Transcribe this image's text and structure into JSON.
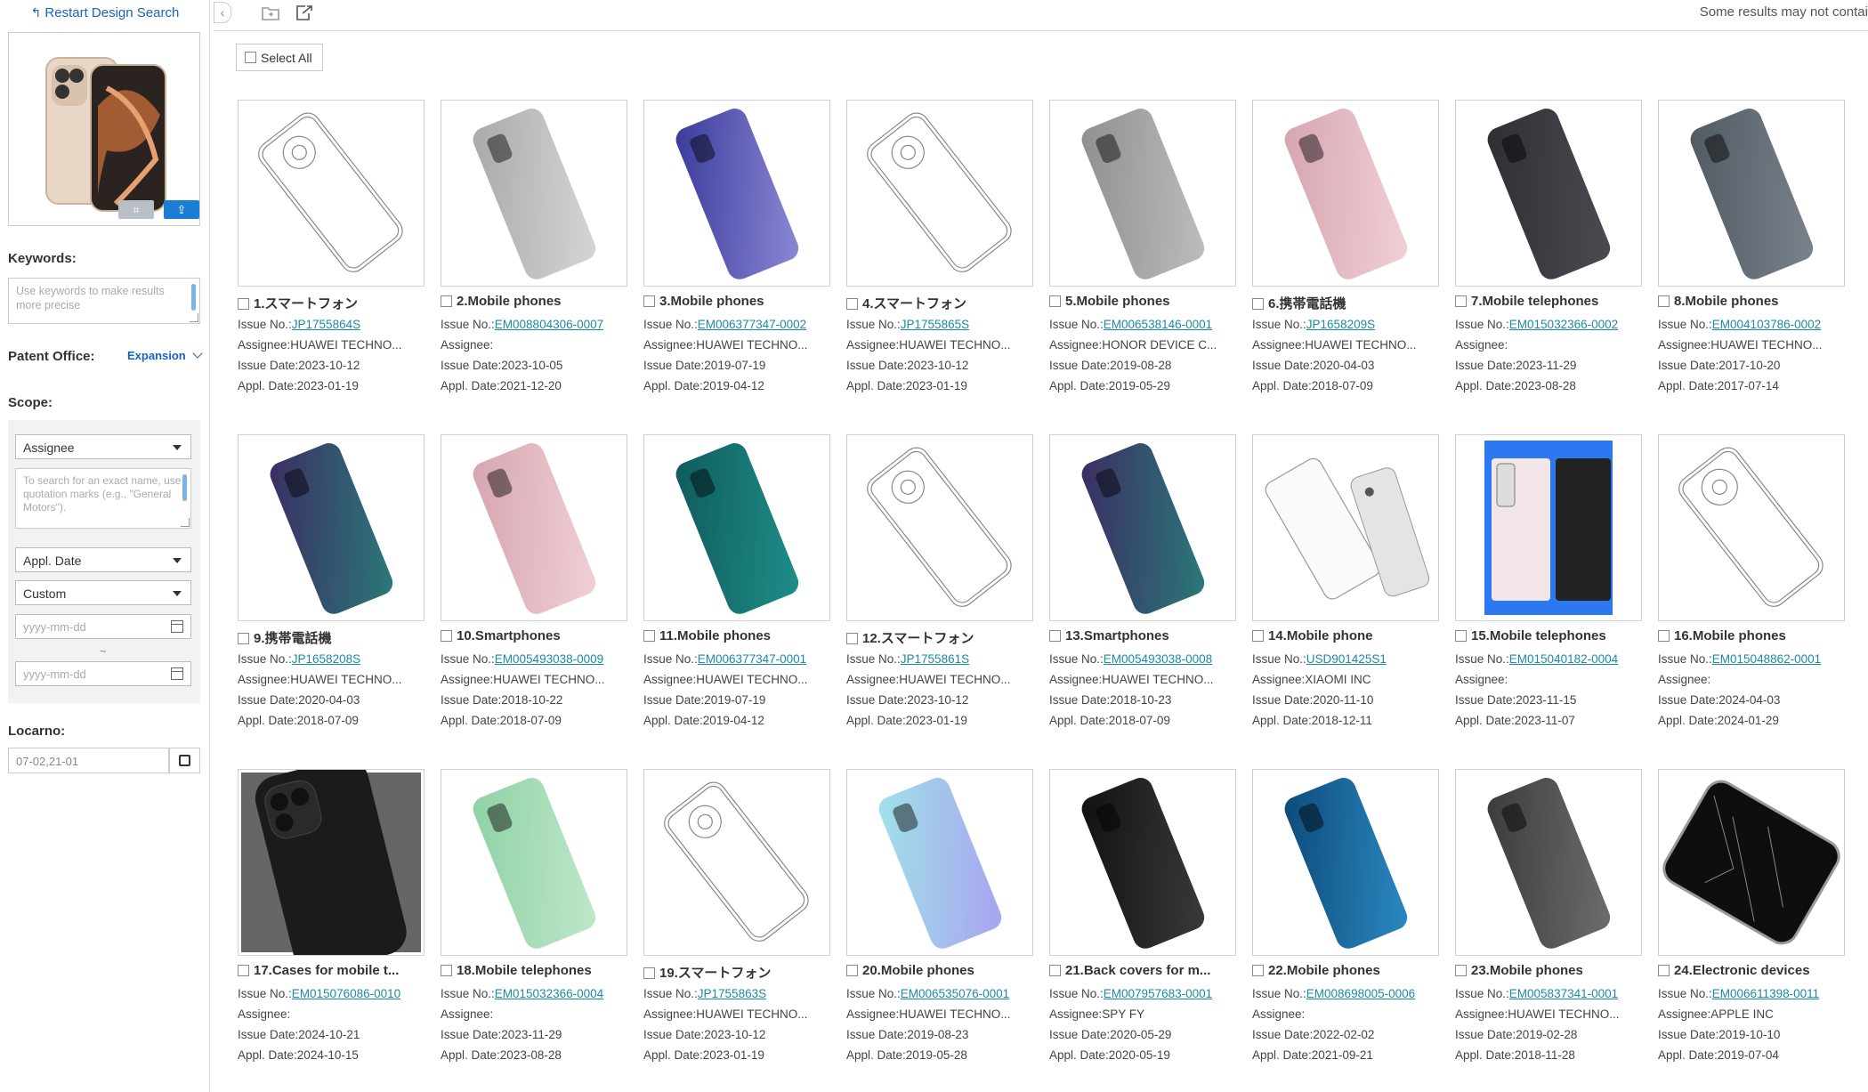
{
  "sidebar": {
    "restart_label": "Restart Design Search",
    "keywords_label": "Keywords:",
    "keywords_placeholder": "Use keywords to make results more precise",
    "patent_office_label": "Patent Office:",
    "expansion_label": "Expansion",
    "scope_label": "Scope:",
    "scope_field": "Assignee",
    "scope_placeholder": "To search for an exact name, use quotation marks (e.g., \"General Motors\").",
    "date_field": "Appl. Date",
    "date_range": "Custom",
    "date_from_placeholder": "yyyy-mm-dd",
    "date_sep": "~",
    "date_to_placeholder": "yyyy-mm-dd",
    "locarno_label": "Locarno:",
    "locarno_value": "07-02,21-01"
  },
  "topbar": {
    "note": "Some results may not contai"
  },
  "results": {
    "select_all_label": "Select All",
    "field_labels": {
      "issue_no": "Issue No.:",
      "assignee": "Assignee:",
      "issue_date": "Issue Date:",
      "appl_date": "Appl. Date:"
    },
    "items": [
      {
        "title": "1.スマートフォン",
        "issue_no": "JP1755864S",
        "assignee": "HUAWEI TECHNO...",
        "issue_date": "2023-10-12",
        "appl_date": "2023-01-19",
        "thumb": "line-art"
      },
      {
        "title": "2.Mobile phones",
        "issue_no": "EM008804306-0007",
        "assignee": "",
        "issue_date": "2023-10-05",
        "appl_date": "2021-12-20",
        "thumb": "silver"
      },
      {
        "title": "3.Mobile phones",
        "issue_no": "EM006377347-0002",
        "assignee": "HUAWEI TECHNO...",
        "issue_date": "2019-07-19",
        "appl_date": "2019-04-12",
        "thumb": "purple"
      },
      {
        "title": "4.スマートフォン",
        "issue_no": "JP1755865S",
        "assignee": "HUAWEI TECHNO...",
        "issue_date": "2023-10-12",
        "appl_date": "2023-01-19",
        "thumb": "line-art"
      },
      {
        "title": "5.Mobile phones",
        "issue_no": "EM006538146-0001",
        "assignee": "HONOR DEVICE C...",
        "issue_date": "2019-08-28",
        "appl_date": "2019-05-29",
        "thumb": "grey"
      },
      {
        "title": "6.携帯電話機",
        "issue_no": "JP1658209S",
        "assignee": "HUAWEI TECHNO...",
        "issue_date": "2020-04-03",
        "appl_date": "2018-07-09",
        "thumb": "pink"
      },
      {
        "title": "7.Mobile telephones",
        "issue_no": "EM015032366-0002",
        "assignee": "",
        "issue_date": "2023-11-29",
        "appl_date": "2023-08-28",
        "thumb": "dark-g"
      },
      {
        "title": "8.Mobile phones",
        "issue_no": "EM004103786-0002",
        "assignee": "HUAWEI TECHNO...",
        "issue_date": "2017-10-20",
        "appl_date": "2017-07-14",
        "thumb": "slate"
      },
      {
        "title": "9.携帯電話機",
        "issue_no": "JP1658208S",
        "assignee": "HUAWEI TECHNO...",
        "issue_date": "2020-04-03",
        "appl_date": "2018-07-09",
        "thumb": "twilight"
      },
      {
        "title": "10.Smartphones",
        "issue_no": "EM005493038-0009",
        "assignee": "HUAWEI TECHNO...",
        "issue_date": "2018-10-22",
        "appl_date": "2018-07-09",
        "thumb": "pink"
      },
      {
        "title": "11.Mobile phones",
        "issue_no": "EM006377347-0001",
        "assignee": "HUAWEI TECHNO...",
        "issue_date": "2019-07-19",
        "appl_date": "2019-04-12",
        "thumb": "teal"
      },
      {
        "title": "12.スマートフォン",
        "issue_no": "JP1755861S",
        "assignee": "HUAWEI TECHNO...",
        "issue_date": "2023-10-12",
        "appl_date": "2023-01-19",
        "thumb": "line-art"
      },
      {
        "title": "13.Smartphones",
        "issue_no": "EM005493038-0008",
        "assignee": "HUAWEI TECHNO...",
        "issue_date": "2018-10-23",
        "appl_date": "2018-07-09",
        "thumb": "twilight"
      },
      {
        "title": "14.Mobile phone",
        "issue_no": "USD901425S1",
        "assignee": "XIAOMI INC",
        "issue_date": "2020-11-10",
        "appl_date": "2018-12-11",
        "thumb": "white-pair"
      },
      {
        "title": "15.Mobile telephones",
        "issue_no": "EM015040182-0004",
        "assignee": "",
        "issue_date": "2023-11-15",
        "appl_date": "2023-11-07",
        "thumb": "blue-bg"
      },
      {
        "title": "16.Mobile phones",
        "issue_no": "EM015048862-0001",
        "assignee": "",
        "issue_date": "2024-04-03",
        "appl_date": "2024-01-29",
        "thumb": "line-art-round"
      },
      {
        "title": "17.Cases for mobile t...",
        "issue_no": "EM015076086-0010",
        "assignee": "",
        "issue_date": "2024-10-21",
        "appl_date": "2024-10-15",
        "thumb": "black-case"
      },
      {
        "title": "18.Mobile telephones",
        "issue_no": "EM015032366-0004",
        "assignee": "",
        "issue_date": "2023-11-29",
        "appl_date": "2023-08-28",
        "thumb": "mint"
      },
      {
        "title": "19.スマートフォン",
        "issue_no": "JP1755863S",
        "assignee": "HUAWEI TECHNO...",
        "issue_date": "2023-10-12",
        "appl_date": "2023-01-19",
        "thumb": "line-art"
      },
      {
        "title": "20.Mobile phones",
        "issue_no": "EM006535076-0001",
        "assignee": "HUAWEI TECHNO...",
        "issue_date": "2019-08-23",
        "appl_date": "2019-05-28",
        "thumb": "aqua"
      },
      {
        "title": "21.Back covers for m...",
        "issue_no": "EM007957683-0001",
        "assignee": "SPY FY",
        "issue_date": "2020-05-29",
        "appl_date": "2020-05-19",
        "thumb": "black-back"
      },
      {
        "title": "22.Mobile phones",
        "issue_no": "EM008698005-0006",
        "assignee": "",
        "issue_date": "2022-02-02",
        "appl_date": "2021-09-21",
        "thumb": "ocean"
      },
      {
        "title": "23.Mobile phones",
        "issue_no": "EM005837341-0001",
        "assignee": "HUAWEI TECHNO...",
        "issue_date": "2019-02-28",
        "appl_date": "2018-11-28",
        "thumb": "dark-grey"
      },
      {
        "title": "24.Electronic devices",
        "issue_no": "EM006611398-0011",
        "assignee": "APPLE INC",
        "issue_date": "2019-10-10",
        "appl_date": "2019-07-04",
        "thumb": "marble"
      }
    ]
  },
  "colors": {
    "link": "#1a8aa6",
    "accent": "#1565c0",
    "upload_button": "#1a7fd4"
  }
}
